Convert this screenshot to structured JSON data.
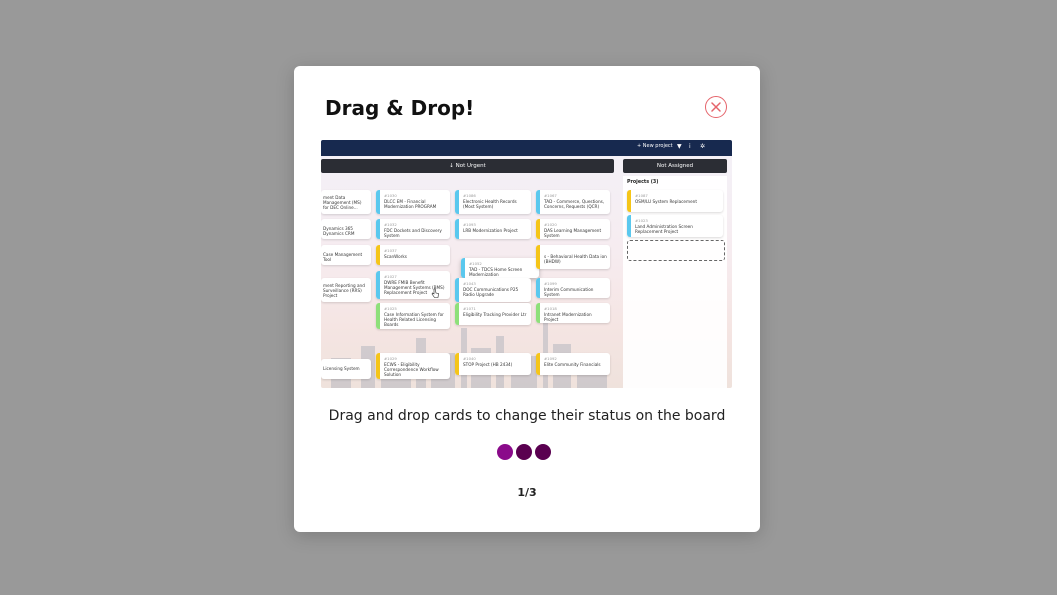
{
  "modal": {
    "title": "Drag & Drop!",
    "close_icon": "close-circle-icon",
    "caption": "Drag and drop cards to change their status on the board",
    "pager": "1/3",
    "colors": {
      "overlay": "#999999",
      "close": "#e5646b",
      "dot_active": "#8a0a8a",
      "dot_inactive": "#5a0050"
    },
    "dots": [
      {
        "state": "active"
      },
      {
        "state": "inactive"
      },
      {
        "state": "inactive"
      }
    ]
  },
  "preview": {
    "topbar": {
      "new_project": "+ New project",
      "icons": [
        "filter-icon",
        "info-icon",
        "gear-icon"
      ]
    },
    "columns": {
      "not_urgent": "↓ Not Urgent",
      "not_assigned": "Not Assigned"
    },
    "side": {
      "title": "Projects (3)",
      "cards": [
        {
          "num": "#1087",
          "text": "OSM/LU System Replacement"
        },
        {
          "num": "#1023",
          "text": "Land Administration Screen Replacement Project"
        }
      ]
    },
    "cards": [
      {
        "num": "",
        "text": "ment Data Management (MS) for DEC Online..."
      },
      {
        "num": "#1030",
        "text": "DLCC EM - Financial Modernization PROGRAM"
      },
      {
        "num": "#1086",
        "text": "Electronic Health Records (Most System)"
      },
      {
        "num": "#1067",
        "text": "TAD - Commerce, Questions, Concerns, Requests (QCR)"
      },
      {
        "num": "",
        "text": "Dynamics 365 Dynamics CRM"
      },
      {
        "num": "#1032",
        "text": "FDC Dockets and Discovery System"
      },
      {
        "num": "#1093",
        "text": "LRB Modernization Project"
      },
      {
        "num": "#1020",
        "text": "DAS Learning Management System"
      },
      {
        "num": "",
        "text": "Case Management Tool"
      },
      {
        "num": "#1037",
        "text": "ScanWorks"
      },
      {
        "num": "#1052",
        "text": "TAD - TDCS Home Screen Modernization"
      },
      {
        "num": "",
        "text": "s - Behavioral Health Data ion (BHDW)"
      },
      {
        "num": "",
        "text": "ment Reporting and Surveillance (RRS) Project"
      },
      {
        "num": "#1027",
        "text": "DWRE FMIB Benefit Management Systems (BMS) Replacement Project"
      },
      {
        "num": "#1043",
        "text": "DOC Communications P25 Radio Upgrade"
      },
      {
        "num": "#1099",
        "text": "Interim Communication System"
      },
      {
        "num": "#1025",
        "text": "Case Information System for Health Related Licensing Boards"
      },
      {
        "num": "#1071",
        "text": "Eligibility Tracking Provider Ltr"
      },
      {
        "num": "#1018",
        "text": "Intranet Modernization Project"
      },
      {
        "num": "",
        "text": "Licensing System"
      },
      {
        "num": "#1029",
        "text": "ECWS - Eligibility Correspondence Workflow Solution"
      },
      {
        "num": "#1040",
        "text": "STOP Project (HB 2434)"
      },
      {
        "num": "#1092",
        "text": "Elite Community Financials"
      }
    ]
  }
}
